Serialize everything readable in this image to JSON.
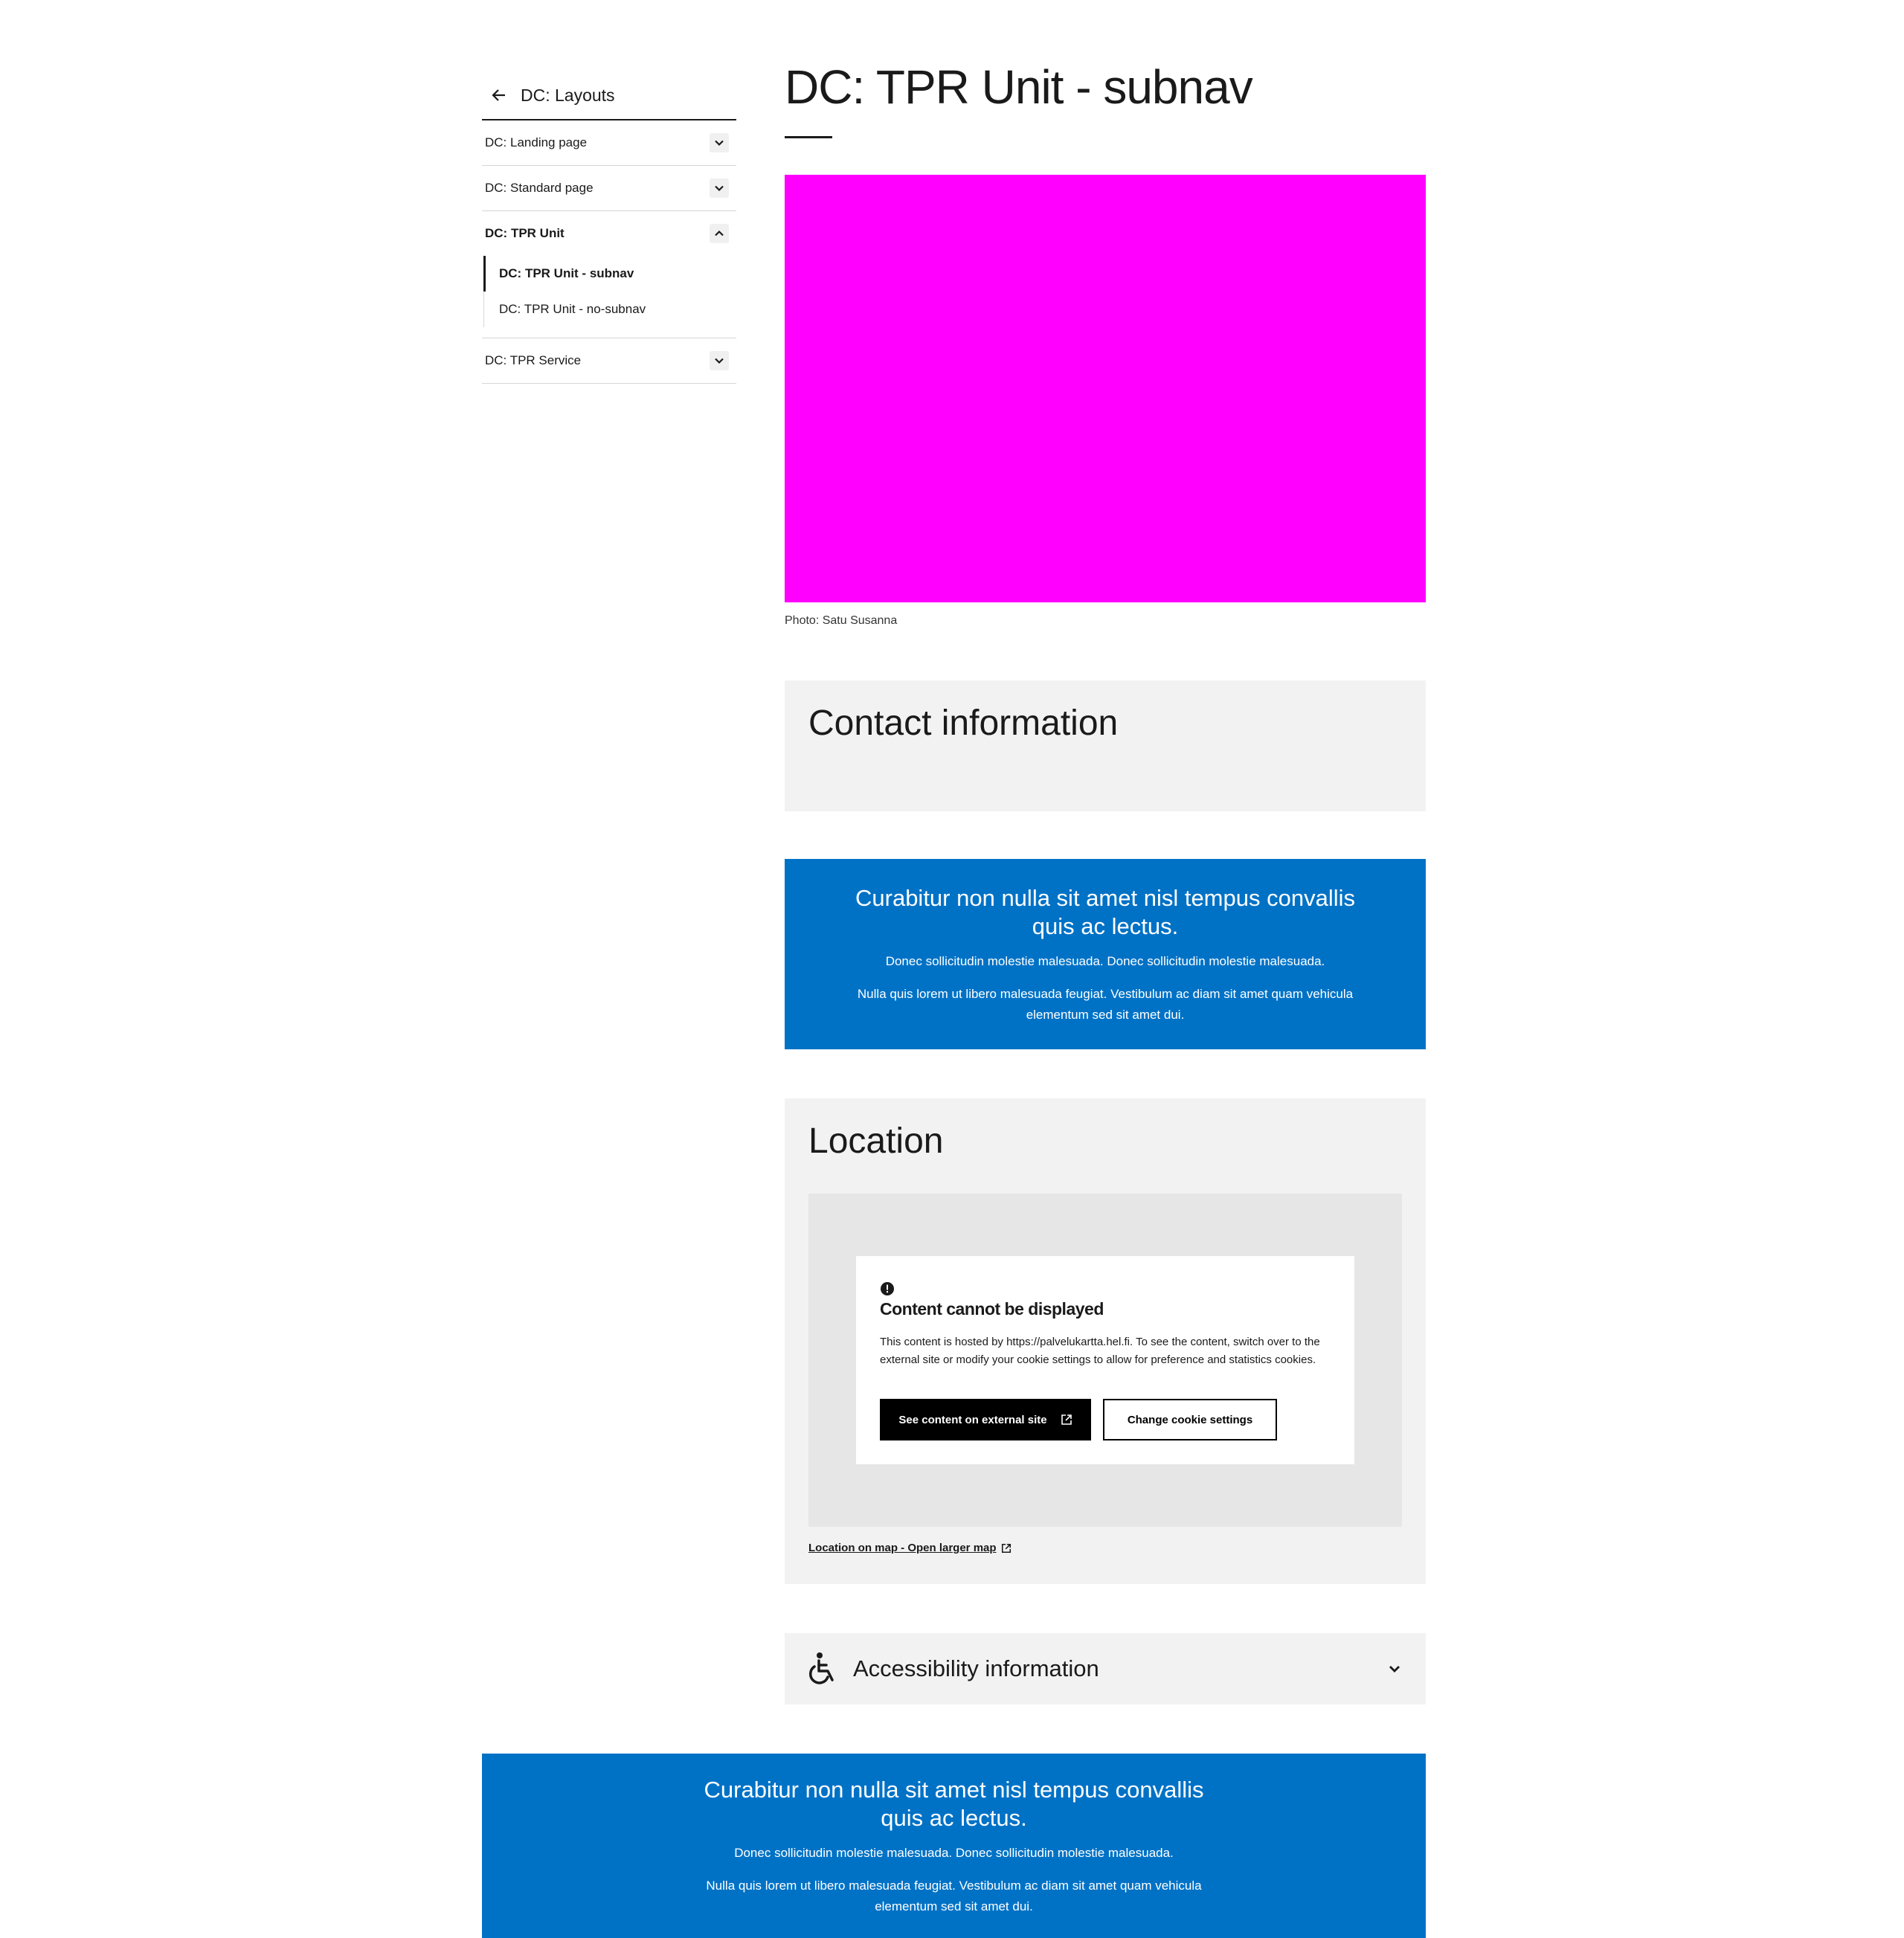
{
  "sidebar": {
    "back_label": "DC: Layouts",
    "items": [
      {
        "label": "DC: Landing page"
      },
      {
        "label": "DC: Standard page"
      },
      {
        "label": "DC: TPR Unit",
        "expanded": true,
        "children": [
          {
            "label": "DC: TPR Unit - subnav",
            "current": true
          },
          {
            "label": "DC: TPR Unit - no-subnav"
          }
        ]
      },
      {
        "label": "DC: TPR Service"
      }
    ]
  },
  "page": {
    "title": "DC: TPR Unit - subnav",
    "photo_caption": "Photo: Satu Susanna"
  },
  "contact": {
    "heading": "Contact information"
  },
  "banner": {
    "title": "Curabitur non nulla sit amet nisl tempus convallis quis ac lectus.",
    "p1": "Donec sollicitudin molestie malesuada. Donec sollicitudin molestie malesuada.",
    "p2": "Nulla quis lorem ut libero malesuada feugiat. Vestibulum ac diam sit amet quam vehicula elementum sed sit amet dui."
  },
  "location": {
    "heading": "Location",
    "notice_title": "Content cannot be displayed",
    "notice_text": "This content is hosted by https://palvelukartta.hel.fi. To see the content, switch over to the external site or modify your cookie settings to allow for preference and statistics cookies.",
    "primary_button": "See content on external site",
    "secondary_button": "Change cookie settings",
    "map_link": "Location on map - Open larger map"
  },
  "accessibility": {
    "label": "Accessibility information"
  },
  "colors": {
    "brand_blue": "#0072c6",
    "image_placeholder": "#ff00ff",
    "panel_gray": "#f2f2f2",
    "map_gray": "#e6e6e6"
  }
}
